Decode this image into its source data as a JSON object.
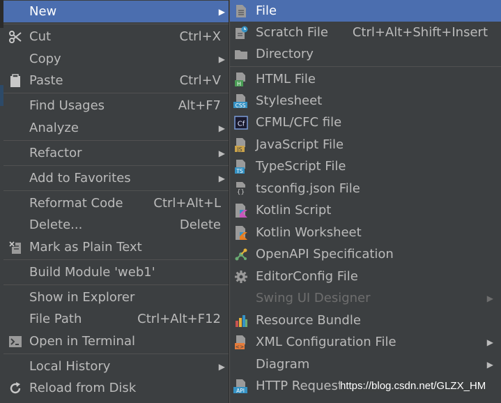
{
  "context_menu": {
    "items": [
      {
        "label": "New",
        "shortcut": "",
        "submenu": true,
        "selected": true
      },
      {
        "label": "Cut",
        "shortcut": "Ctrl+X",
        "icon": "scissors-icon"
      },
      {
        "label": "Copy",
        "shortcut": "",
        "submenu": true
      },
      {
        "label": "Paste",
        "shortcut": "Ctrl+V",
        "icon": "clipboard-icon"
      },
      {
        "label": "Find Usages",
        "shortcut": "Alt+F7"
      },
      {
        "label": "Analyze",
        "shortcut": "",
        "submenu": true
      },
      {
        "label": "Refactor",
        "shortcut": "",
        "submenu": true
      },
      {
        "label": "Add to Favorites",
        "shortcut": "",
        "submenu": true
      },
      {
        "label": "Reformat Code",
        "shortcut": "Ctrl+Alt+L"
      },
      {
        "label": "Delete...",
        "shortcut": "Delete"
      },
      {
        "label": "Mark as Plain Text",
        "shortcut": "",
        "icon": "plain-text-icon"
      },
      {
        "label": "Build Module 'web1'",
        "shortcut": ""
      },
      {
        "label": "Show in Explorer",
        "shortcut": ""
      },
      {
        "label": "File Path",
        "shortcut": "Ctrl+Alt+F12"
      },
      {
        "label": "Open in Terminal",
        "shortcut": "",
        "icon": "terminal-icon"
      },
      {
        "label": "Local History",
        "shortcut": "",
        "submenu": true
      },
      {
        "label": "Reload from Disk",
        "shortcut": "",
        "icon": "reload-icon"
      }
    ]
  },
  "new_submenu": {
    "items": [
      {
        "label": "File",
        "shortcut": "",
        "icon": "file-icon",
        "selected": true
      },
      {
        "label": "Scratch File",
        "shortcut": "Ctrl+Alt+Shift+Insert",
        "icon": "scratch-file-icon"
      },
      {
        "label": "Directory",
        "shortcut": "",
        "icon": "folder-icon"
      },
      {
        "label": "HTML File",
        "shortcut": "",
        "icon": "html-file-icon"
      },
      {
        "label": "Stylesheet",
        "shortcut": "",
        "icon": "css-file-icon"
      },
      {
        "label": "CFML/CFC file",
        "shortcut": "",
        "icon": "cfml-file-icon"
      },
      {
        "label": "JavaScript File",
        "shortcut": "",
        "icon": "javascript-file-icon"
      },
      {
        "label": "TypeScript File",
        "shortcut": "",
        "icon": "typescript-file-icon"
      },
      {
        "label": "tsconfig.json File",
        "shortcut": "",
        "icon": "tsconfig-file-icon"
      },
      {
        "label": "Kotlin Script",
        "shortcut": "",
        "icon": "kotlin-script-icon"
      },
      {
        "label": "Kotlin Worksheet",
        "shortcut": "",
        "icon": "kotlin-worksheet-icon"
      },
      {
        "label": "OpenAPI Specification",
        "shortcut": "",
        "icon": "openapi-icon"
      },
      {
        "label": "EditorConfig File",
        "shortcut": "",
        "icon": "gear-icon"
      },
      {
        "label": "Swing UI Designer",
        "shortcut": "",
        "submenu": true,
        "disabled": true
      },
      {
        "label": "Resource Bundle",
        "shortcut": "",
        "icon": "resource-bundle-icon"
      },
      {
        "label": "XML Configuration File",
        "shortcut": "",
        "icon": "xml-file-icon",
        "submenu": true
      },
      {
        "label": "Diagram",
        "shortcut": "",
        "submenu": true
      },
      {
        "label": "HTTP Request",
        "shortcut": "",
        "icon": "api-icon"
      }
    ]
  },
  "icon_labels": {
    "html": "H",
    "css": "CSS",
    "cfml": "Cf",
    "js": "JS",
    "ts": "TS",
    "tsconfig": "{}",
    "api": "API",
    "xml": "<>"
  },
  "watermark": "https://blog.csdn.net/GLZX_HM",
  "colors": {
    "menu_bg": "#3c3f41",
    "selection": "#4b6eaf",
    "text": "#bbbbbb",
    "disabled": "#6e6e6e",
    "separator": "#515151"
  }
}
